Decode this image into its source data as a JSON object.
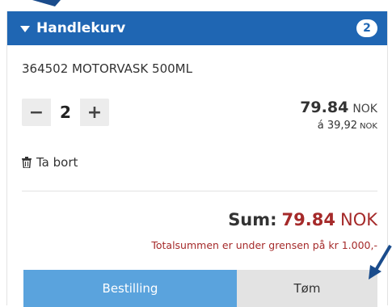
{
  "cart": {
    "title": "Handlekurv",
    "count": "2",
    "item": {
      "name": "364502 MOTORVASK 500ML",
      "quantity": "2",
      "decrease": "−",
      "increase": "+",
      "price": "79.84",
      "price_currency": "NOK",
      "unit_price": "á 39,92",
      "unit_currency": "NOK",
      "remove_label": "Ta bort"
    },
    "sum_label": "Sum:",
    "sum_amount": "79.84",
    "sum_currency": "NOK",
    "notice": "Totalsummen er under grensen på kr 1.000,-",
    "order_button": "Bestilling",
    "empty_button": "Tøm"
  },
  "colors": {
    "header": "#1f66b3",
    "order_button": "#5aa3dd",
    "sum_amount": "#a52a2a",
    "arrow": "#1a4c8c"
  }
}
